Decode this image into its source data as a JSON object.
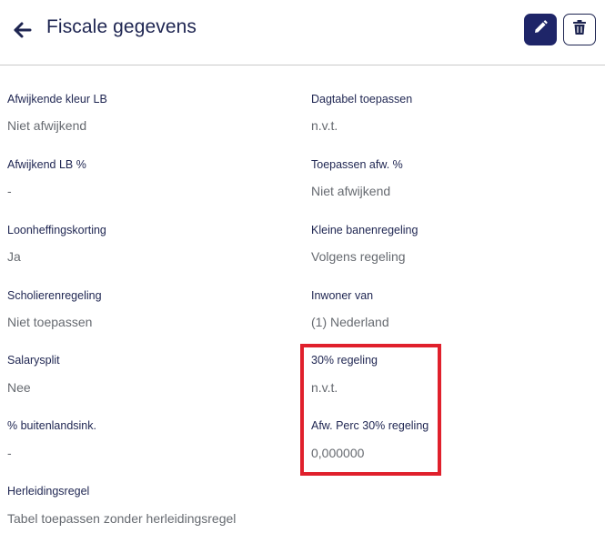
{
  "header": {
    "title": "Fiscale gegevens",
    "back_icon": "arrow-left-icon",
    "edit_icon": "pencil-icon",
    "delete_icon": "trash-icon",
    "accent_color": "#1e2568"
  },
  "fields": {
    "afwijkende_kleur_lb": {
      "label": "Afwijkende kleur LB",
      "value": "Niet afwijkend"
    },
    "dagtabel_toepassen": {
      "label": "Dagtabel toepassen",
      "value": "n.v.t."
    },
    "afwijkend_lb_pct": {
      "label": "Afwijkend LB %",
      "value": "-"
    },
    "toepassen_afw_pct": {
      "label": "Toepassen afw. %",
      "value": "Niet afwijkend"
    },
    "loonheffingskorting": {
      "label": "Loonheffingskorting",
      "value": "Ja"
    },
    "kleine_banenregeling": {
      "label": "Kleine banenregeling",
      "value": "Volgens regeling"
    },
    "scholierenregeling": {
      "label": "Scholierenregeling",
      "value": "Niet toepassen"
    },
    "inwoner_van": {
      "label": "Inwoner van",
      "value": "(1) Nederland"
    },
    "salarysplit": {
      "label": "Salarysplit",
      "value": "Nee"
    },
    "regeling_30": {
      "label": "30% regeling",
      "value": "n.v.t."
    },
    "buitenlandsink": {
      "label": "% buitenlandsink.",
      "value": "-"
    },
    "afw_perc_30": {
      "label": "Afw. Perc 30% regeling",
      "value": "0,000000"
    },
    "herleidingsregel": {
      "label": "Herleidingsregel",
      "value": "Tabel toepassen zonder herleidingsregel"
    }
  },
  "highlight_color": "#e0202c"
}
